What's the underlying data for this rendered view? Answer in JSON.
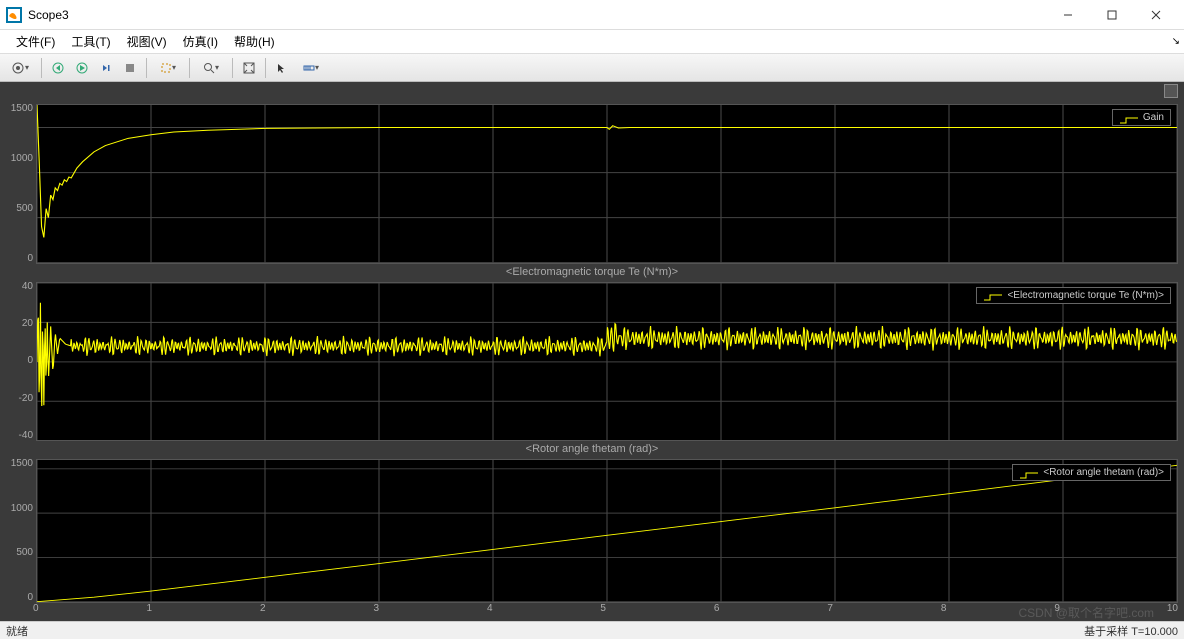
{
  "window": {
    "title": "Scope3"
  },
  "menus": {
    "file": "文件(F)",
    "tools": "工具(T)",
    "view": "视图(V)",
    "sim": "仿真(I)",
    "help": "帮助(H)"
  },
  "status": {
    "left": "就绪",
    "right": "基于采样   T=10.000"
  },
  "watermark": "CSDN @取个名字吧.com",
  "chart_data": [
    {
      "type": "line",
      "title": "",
      "legend": "Gain",
      "xlabel": "",
      "ylabel": "",
      "xlim": [
        0,
        10
      ],
      "ylim": [
        0,
        1750
      ],
      "yticks": [
        0,
        500,
        1000,
        1500
      ],
      "x": [
        0,
        0.02,
        0.04,
        0.06,
        0.08,
        0.1,
        0.12,
        0.14,
        0.16,
        0.18,
        0.2,
        0.22,
        0.24,
        0.26,
        0.28,
        0.3,
        0.35,
        0.4,
        0.5,
        0.6,
        0.8,
        1.0,
        1.2,
        1.5,
        2,
        3,
        5,
        5.02,
        5.05,
        5.1,
        5.2,
        6,
        8,
        10
      ],
      "y": [
        1750,
        1100,
        400,
        280,
        600,
        500,
        750,
        700,
        830,
        800,
        880,
        860,
        920,
        900,
        950,
        940,
        1050,
        1120,
        1230,
        1300,
        1380,
        1420,
        1450,
        1470,
        1490,
        1500,
        1500,
        1480,
        1520,
        1495,
        1500,
        1500,
        1500,
        1500
      ]
    },
    {
      "type": "line",
      "title": "<Electromagnetic torque Te (N*m)>",
      "legend": "<Electromagnetic torque Te (N*m)>",
      "xlabel": "",
      "ylabel": "",
      "xlim": [
        0,
        10
      ],
      "ylim": [
        -40,
        40
      ],
      "yticks": [
        -40,
        -20,
        0,
        20,
        40
      ],
      "note": "Initial transient oscillation ±35 settling to ~8 with noise; step to ~12 with noise at t=5",
      "x": [
        0,
        0.01,
        0.02,
        0.03,
        0.04,
        0.05,
        0.06,
        0.07,
        0.08,
        0.09,
        0.1,
        0.12,
        0.14,
        0.16,
        0.18,
        0.2,
        0.25,
        0.3,
        0.5,
        1,
        2,
        3,
        4,
        5,
        5.01,
        5.05,
        5.1,
        6,
        8,
        10
      ],
      "y": [
        0,
        35,
        -28,
        30,
        -35,
        28,
        -22,
        25,
        -15,
        20,
        -10,
        18,
        -6,
        15,
        4,
        12,
        9,
        8,
        8,
        8,
        8,
        8,
        8,
        8,
        18,
        20,
        12,
        12,
        12,
        12
      ],
      "noise_amp_before": 5,
      "noise_amp_after": 6
    },
    {
      "type": "line",
      "title": "<Rotor angle thetam (rad)>",
      "legend": "<Rotor angle thetam (rad)>",
      "xlabel": "",
      "ylabel": "",
      "xlim": [
        0,
        10
      ],
      "ylim": [
        0,
        1600
      ],
      "yticks": [
        0,
        500,
        1000,
        1500
      ],
      "x": [
        0,
        0.5,
        1,
        2,
        3,
        4,
        5,
        6,
        7,
        8,
        9,
        10
      ],
      "y": [
        0,
        50,
        120,
        275,
        430,
        590,
        750,
        905,
        1060,
        1220,
        1380,
        1540
      ]
    }
  ],
  "xticks": [
    0,
    1,
    2,
    3,
    4,
    5,
    6,
    7,
    8,
    9,
    10
  ]
}
